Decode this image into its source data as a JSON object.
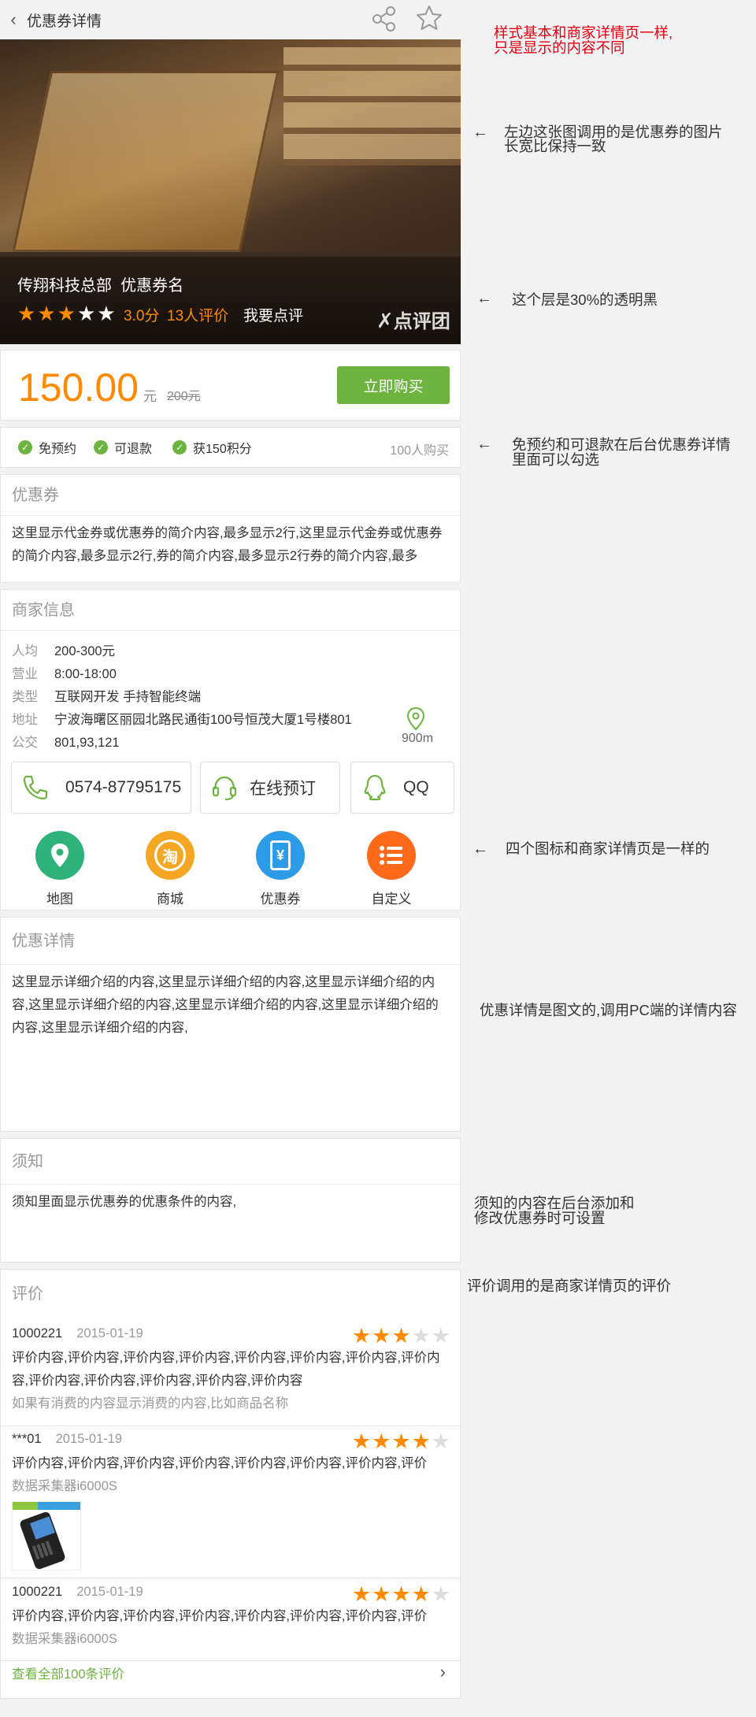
{
  "header": {
    "title": "优惠券详情",
    "back_icon": "chevron-left-icon",
    "share_icon": "share-icon",
    "favorite_icon": "star-outline-icon"
  },
  "hero": {
    "merchant": "传翔科技总部",
    "coupon_name": "优惠券名",
    "rating": 3,
    "rating_max": 5,
    "score": "3.0分",
    "reviews": "13人评价",
    "comment": "我要点评",
    "logo_text": "点评团"
  },
  "price": {
    "amount": "150.00",
    "unit": "元",
    "original": "200元",
    "buy_label": "立即购买"
  },
  "tags": {
    "items": [
      "免预约",
      "可退款",
      "获150积分"
    ],
    "buyers": "100人购买"
  },
  "coupon": {
    "title": "优惠券",
    "text": "这里显示代金券或优惠券的简介内容,最多显示2行,这里显示代金券或优惠券的简介内容,最多显示2行,券的简介内容,最多显示2行券的简介内容,最多"
  },
  "merchant": {
    "title": "商家信息",
    "rows": [
      {
        "k": "人均",
        "v": "200-300元"
      },
      {
        "k": "营业",
        "v": "8:00-18:00"
      },
      {
        "k": "类型",
        "v": "互联网开发 手持智能终端"
      },
      {
        "k": "地址",
        "v": "宁波海曙区丽园北路民通街100号恒茂大厦1号楼801"
      },
      {
        "k": "公交",
        "v": "801,93,121"
      }
    ],
    "distance": "900m",
    "phone": "0574-87795175",
    "booking": "在线预订",
    "qq": "QQ",
    "shortcuts": [
      {
        "label": "地图",
        "color": "#2db37a",
        "icon": "map-pin-icon"
      },
      {
        "label": "商城",
        "color": "#f5a623",
        "icon": "mall-icon",
        "glyph": "淘"
      },
      {
        "label": "优惠券",
        "color": "#2c9be8",
        "icon": "coupon-icon",
        "glyph": "¥"
      },
      {
        "label": "自定义",
        "color": "#ff6a1a",
        "icon": "list-icon"
      }
    ]
  },
  "detail": {
    "title": "优惠详情",
    "text": "这里显示详细介绍的内容,这里显示详细介绍的内容,这里显示详细介绍的内容,这里显示详细介绍的内容,这里显示详细介绍的内容,这里显示详细介绍的内容,这里显示详细介绍的内容,"
  },
  "notice": {
    "title": "须知",
    "text": "须知里面显示优惠券的优惠条件的内容,"
  },
  "reviews": {
    "title": "评价",
    "items": [
      {
        "user": "1000221",
        "date": "2015-01-19",
        "stars": 3,
        "body": "评价内容,评价内容,评价内容,评价内容,评价内容,评价内容,评价内容,评价内容,评价内容,评价内容,评价内容,评价内容,评价内容",
        "extra": "如果有消费的内容显示消费的内容,比如商品名称"
      },
      {
        "user": "***01",
        "date": "2015-01-19",
        "stars": 4,
        "body": "评价内容,评价内容,评价内容,评价内容,评价内容,评价内容,评价内容,评价",
        "extra": "数据采集器i6000S"
      },
      {
        "user": "1000221",
        "date": "2015-01-19",
        "stars": 4,
        "body": "评价内容,评价内容,评价内容,评价内容,评价内容,评价内容,评价内容,评价",
        "extra": "数据采集器i6000S"
      }
    ],
    "see_all": "查看全部100条评价"
  },
  "annotations": {
    "n1a": "样式基本和商家详情页一样,",
    "n1b": "只是显示的内容不同",
    "n2a": "左边这张图调用的是优惠券的图片",
    "n2b": "长宽比保持一致",
    "n3": "这个层是30%的透明黑",
    "n4a": "免预约和可退款在后台优惠券详情",
    "n4b": "里面可以勾选",
    "n5": "四个图标和商家详情页是一样的",
    "n6": "优惠详情是图文的,调用PC端的详情内容",
    "n7a": "须知的内容在后台添加和",
    "n7b": "修改优惠券时可设置",
    "n8": "评价调用的是商家详情页的评价"
  }
}
